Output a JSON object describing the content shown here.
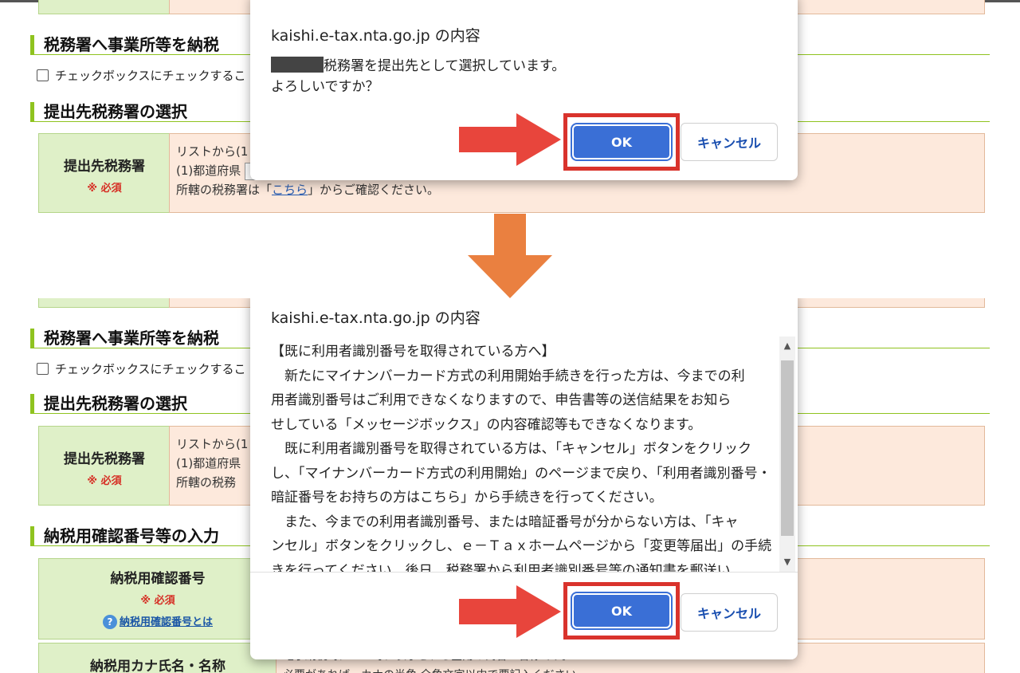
{
  "page": {
    "section_business_title": "税務署へ事業所等を納税",
    "section_business_title_short": "税務署へ事業所等を納税",
    "checkbox_text": "チェックボックスにチェックするこ",
    "section_office_title": "提出先税務署の選択",
    "office_label": "提出先税務署",
    "required_label": "※ 必須",
    "office_line1": "リストから(1",
    "office_line2": "(1)都道府県",
    "office_line3_prefix": "所轄の税務署は「",
    "office_link": "こちら",
    "office_line3_suffix": "」からご確認ください。",
    "office_line3_short": "所轄の税務",
    "section_tax_title": "納税用確認番号等の入力",
    "tax_number_label": "納税用確認番号",
    "tax_number_help": "納税用確認番号とは",
    "kana_label": "納税用カナ氏名・名称",
    "kana_note1": "電子納税時にATM等に表示される全角の氏名・名称です。",
    "kana_note2": "必要があれば、カナの半角 全角文字以内で要記入ください"
  },
  "dialog1": {
    "title": "kaishi.e-tax.nta.go.jp の内容",
    "message_line1": "税務署を提出先として選択しています。",
    "message_line2": "よろしいですか？",
    "ok_label": "OK",
    "cancel_label": "キャンセル"
  },
  "dialog2": {
    "title": "kaishi.e-tax.nta.go.jp の内容",
    "lines": [
      "【既に利用者識別番号を取得されている方へ】",
      "　新たにマイナンバーカード方式の利用開始手続きを行った方は、今までの利",
      "用者識別番号はご利用できなくなりますので、申告書等の送信結果をお知ら",
      "せしている「メッセージボックス」の内容確認等もできなくなります。",
      "　既に利用者識別番号を取得されている方は、「キャンセル」ボタンをクリック",
      "し、「マイナンバーカード方式の利用開始」のページまで戻り、「利用者識別番号・",
      "暗証番号をお持ちの方はこちら」から手続きを行ってください。",
      "　また、今までの利用者識別番号、または暗証番号が分からない方は、「キャ",
      "ンセル」ボタンをクリックし、ｅ－Ｔａｘホームページから「変更等届出」の手続",
      "きを行ってください。後日、税務署から利用者識別番号等の通知書を郵送い"
    ],
    "ok_label": "OK",
    "cancel_label": "キャンセル"
  },
  "colors": {
    "accent_green": "#8fc31f",
    "ok_blue": "#3a6fd6",
    "highlight_red": "#d9332c",
    "down_arrow_orange": "#ea8040"
  }
}
